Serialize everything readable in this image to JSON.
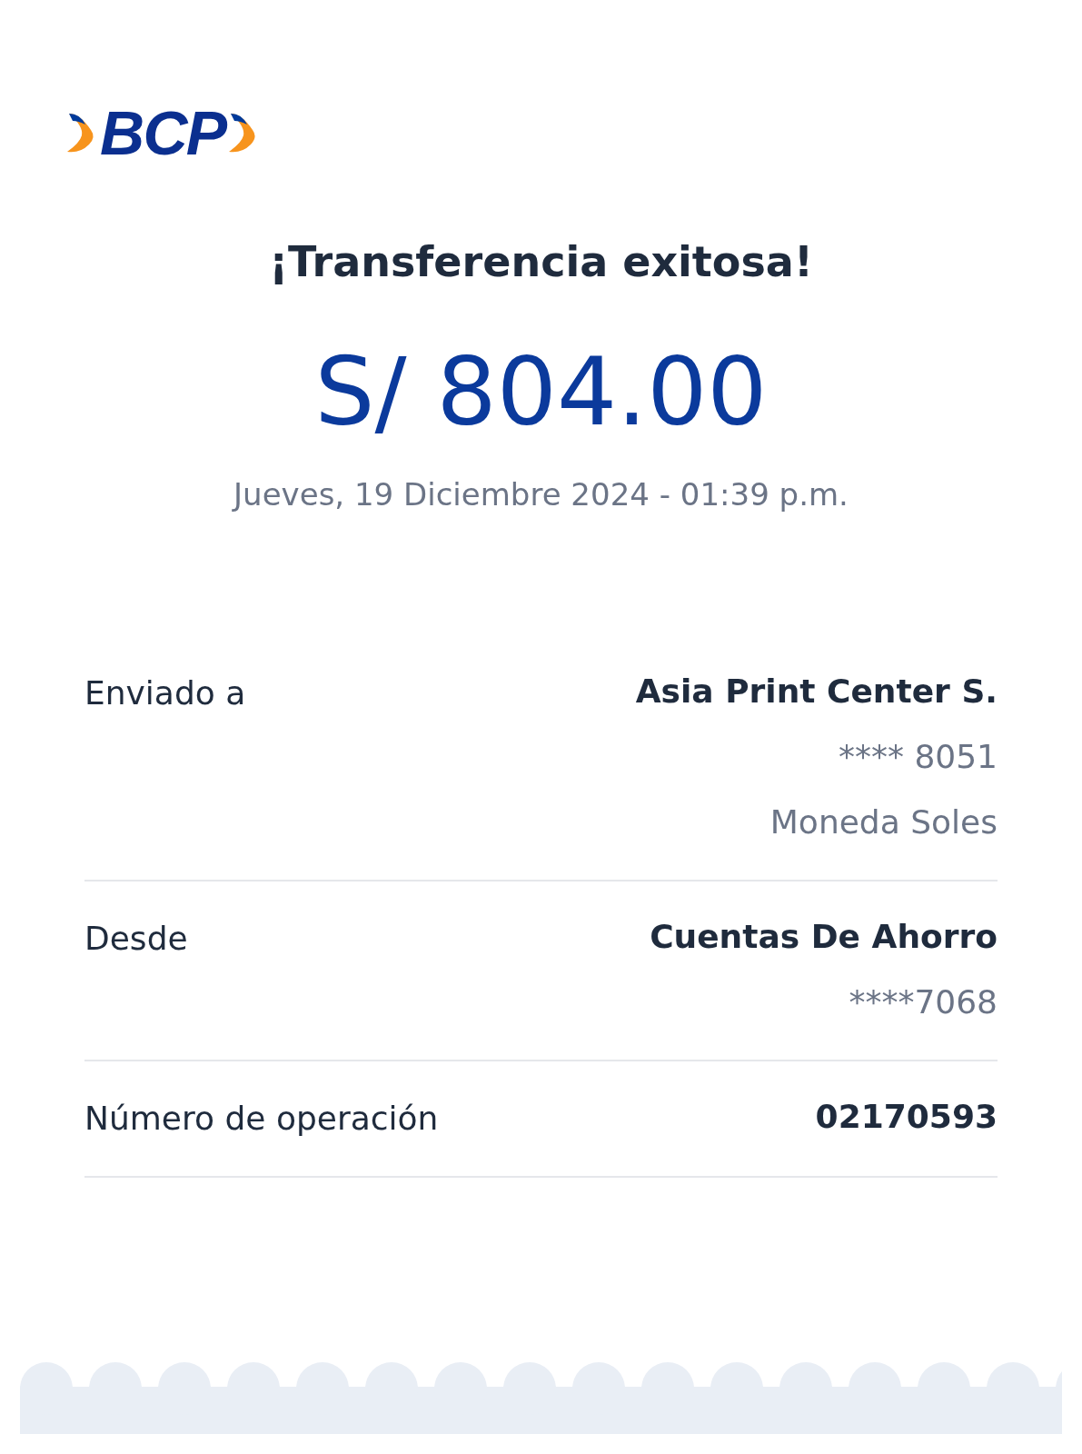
{
  "logo": {
    "text": "BCP"
  },
  "title": "¡Transferencia exitosa!",
  "amount": "S/ 804.00",
  "datetime": "Jueves, 19 Diciembre 2024 - 01:39 p.m.",
  "details": [
    {
      "label": "Enviado a",
      "values": [
        "Asia Print Center S.",
        "**** 8051",
        "Moneda Soles"
      ]
    },
    {
      "label": "Desde",
      "values": [
        "Cuentas De Ahorro",
        "****7068"
      ]
    },
    {
      "label": "Número de operación",
      "values": [
        "02170593"
      ]
    }
  ]
}
